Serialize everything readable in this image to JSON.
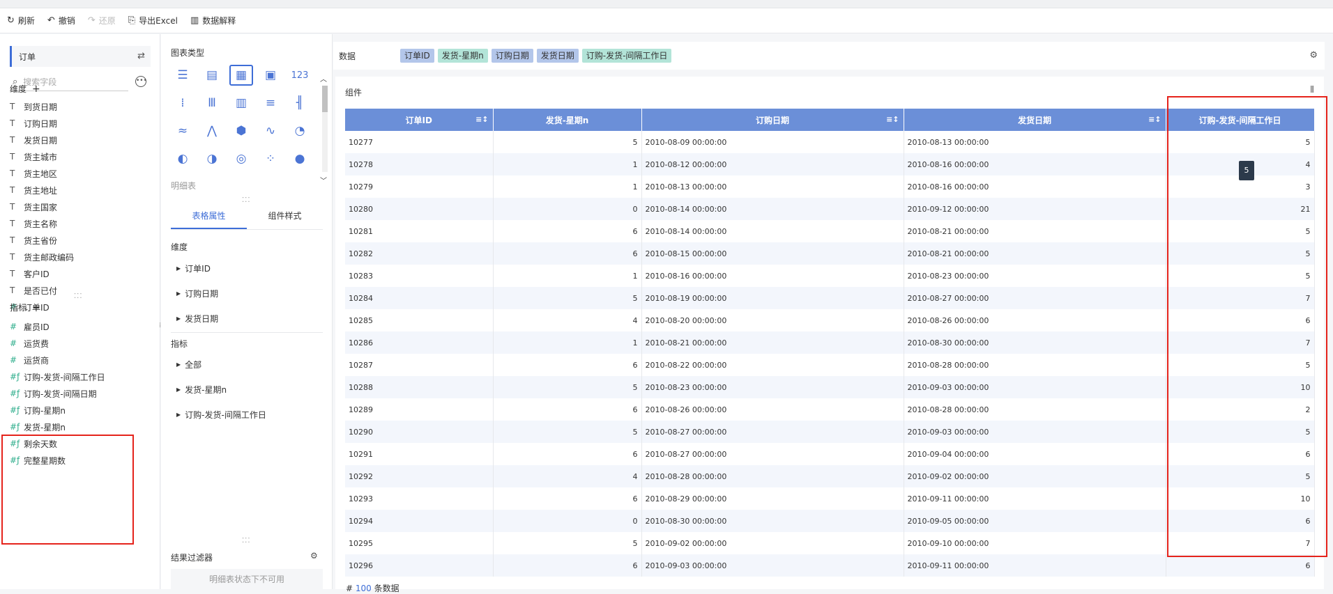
{
  "toolbar": {
    "refresh": "刷新",
    "undo": "撤销",
    "redo": "还原",
    "export": "导出Excel",
    "explain": "数据解释"
  },
  "left": {
    "dataset": "订单",
    "search_placeholder": "搜索字段",
    "dimensions_title": "维度",
    "dimensions": [
      {
        "label": "到货日期",
        "type": "text"
      },
      {
        "label": "订购日期",
        "type": "text"
      },
      {
        "label": "发货日期",
        "type": "text"
      },
      {
        "label": "货主城市",
        "type": "text"
      },
      {
        "label": "货主地区",
        "type": "text"
      },
      {
        "label": "货主地址",
        "type": "text"
      },
      {
        "label": "货主国家",
        "type": "text"
      },
      {
        "label": "货主名称",
        "type": "text"
      },
      {
        "label": "货主省份",
        "type": "text"
      },
      {
        "label": "货主邮政编码",
        "type": "text"
      },
      {
        "label": "客户ID",
        "type": "text"
      },
      {
        "label": "是否已付",
        "type": "text"
      },
      {
        "label": "订单ID",
        "type": "number"
      }
    ],
    "metrics_title": "指标",
    "metrics": [
      {
        "label": "雇员ID",
        "type": "number"
      },
      {
        "label": "运货费",
        "type": "number"
      },
      {
        "label": "运货商",
        "type": "number"
      },
      {
        "label": "订购-发货-间隔工作日",
        "type": "calc"
      },
      {
        "label": "订购-发货-间隔日期",
        "type": "calc"
      },
      {
        "label": "订购-星期n",
        "type": "calc"
      },
      {
        "label": "发货-星期n",
        "type": "calc"
      },
      {
        "label": "剩余天数",
        "type": "calc"
      },
      {
        "label": "完整星期数",
        "type": "calc"
      }
    ]
  },
  "middle": {
    "chart_type_title": "图表类型",
    "chart_icons": [
      "table-icon",
      "cross-table-icon",
      "detail-table-icon",
      "kpi-icon",
      "number-icon",
      "scatter-bar-icon",
      "multi-bar-icon",
      "bar-chart-icon",
      "stacked-bar-icon",
      "grouped-bar-icon",
      "wave-icon",
      "line-cross-icon",
      "hexagon-icon",
      "area-chart-icon",
      "gauge-icon",
      "pie-icon",
      "half-pie-icon",
      "radar-icon",
      "dots-icon",
      "bubble-icon"
    ],
    "chart_glyphs": [
      "☰",
      "▤",
      "▦",
      "▣",
      "123",
      "⁞",
      "Ⅲ",
      "▥",
      "≡",
      "╢",
      "≈",
      "⋀",
      "⬢",
      "∿",
      "◔",
      "◐",
      "◑",
      "◎",
      "⁘",
      "●"
    ],
    "selected_type": "明细表",
    "tab_props": "表格属性",
    "tab_style": "组件样式",
    "dim_title": "维度",
    "dim_items": [
      "订单ID",
      "订购日期",
      "发货日期"
    ],
    "metric_title": "指标",
    "metric_items": [
      "全部",
      "发货-星期n",
      "订购-发货-间隔工作日"
    ],
    "filter_title": "结果过滤器",
    "filter_note": "明细表状态下不可用"
  },
  "data_bar": {
    "label": "数据",
    "pills": [
      {
        "text": "订单ID",
        "kind": "dim"
      },
      {
        "text": "发货-星期n",
        "kind": "met"
      },
      {
        "text": "订购日期",
        "kind": "dim"
      },
      {
        "text": "发货日期",
        "kind": "dim"
      },
      {
        "text": "订购-发货-间隔工作日",
        "kind": "met"
      }
    ]
  },
  "component": {
    "title": "组件",
    "columns": [
      "订单ID",
      "发货-星期n",
      "订购日期",
      "发货日期",
      "订购-发货-间隔工作日"
    ],
    "rows": [
      [
        "10277",
        "5",
        "2010-08-09 00:00:00",
        "2010-08-13 00:00:00",
        "5"
      ],
      [
        "10278",
        "1",
        "2010-08-12 00:00:00",
        "2010-08-16 00:00:00",
        "4"
      ],
      [
        "10279",
        "1",
        "2010-08-13 00:00:00",
        "2010-08-16 00:00:00",
        "3"
      ],
      [
        "10280",
        "0",
        "2010-08-14 00:00:00",
        "2010-09-12 00:00:00",
        "21"
      ],
      [
        "10281",
        "6",
        "2010-08-14 00:00:00",
        "2010-08-21 00:00:00",
        "5"
      ],
      [
        "10282",
        "6",
        "2010-08-15 00:00:00",
        "2010-08-21 00:00:00",
        "5"
      ],
      [
        "10283",
        "1",
        "2010-08-16 00:00:00",
        "2010-08-23 00:00:00",
        "5"
      ],
      [
        "10284",
        "5",
        "2010-08-19 00:00:00",
        "2010-08-27 00:00:00",
        "7"
      ],
      [
        "10285",
        "4",
        "2010-08-20 00:00:00",
        "2010-08-26 00:00:00",
        "6"
      ],
      [
        "10286",
        "1",
        "2010-08-21 00:00:00",
        "2010-08-30 00:00:00",
        "7"
      ],
      [
        "10287",
        "6",
        "2010-08-22 00:00:00",
        "2010-08-28 00:00:00",
        "5"
      ],
      [
        "10288",
        "5",
        "2010-08-23 00:00:00",
        "2010-09-03 00:00:00",
        "10"
      ],
      [
        "10289",
        "6",
        "2010-08-26 00:00:00",
        "2010-08-28 00:00:00",
        "2"
      ],
      [
        "10290",
        "5",
        "2010-08-27 00:00:00",
        "2010-09-03 00:00:00",
        "5"
      ],
      [
        "10291",
        "6",
        "2010-08-27 00:00:00",
        "2010-09-04 00:00:00",
        "6"
      ],
      [
        "10292",
        "4",
        "2010-08-28 00:00:00",
        "2010-09-02 00:00:00",
        "5"
      ],
      [
        "10293",
        "6",
        "2010-08-29 00:00:00",
        "2010-09-11 00:00:00",
        "10"
      ],
      [
        "10294",
        "0",
        "2010-08-30 00:00:00",
        "2010-09-05 00:00:00",
        "6"
      ],
      [
        "10295",
        "5",
        "2010-09-02 00:00:00",
        "2010-09-10 00:00:00",
        "7"
      ],
      [
        "10296",
        "6",
        "2010-09-03 00:00:00",
        "2010-09-11 00:00:00",
        "6"
      ]
    ],
    "tooltip": "5",
    "footer_count": "100",
    "footer_text": "条数据"
  },
  "colors": {
    "accent": "#3d6dd7",
    "header": "#6b8fd8",
    "highlight": "#e5231b",
    "dim_pill": "#b3c6ea",
    "metric_pill": "#b3e4d8"
  }
}
